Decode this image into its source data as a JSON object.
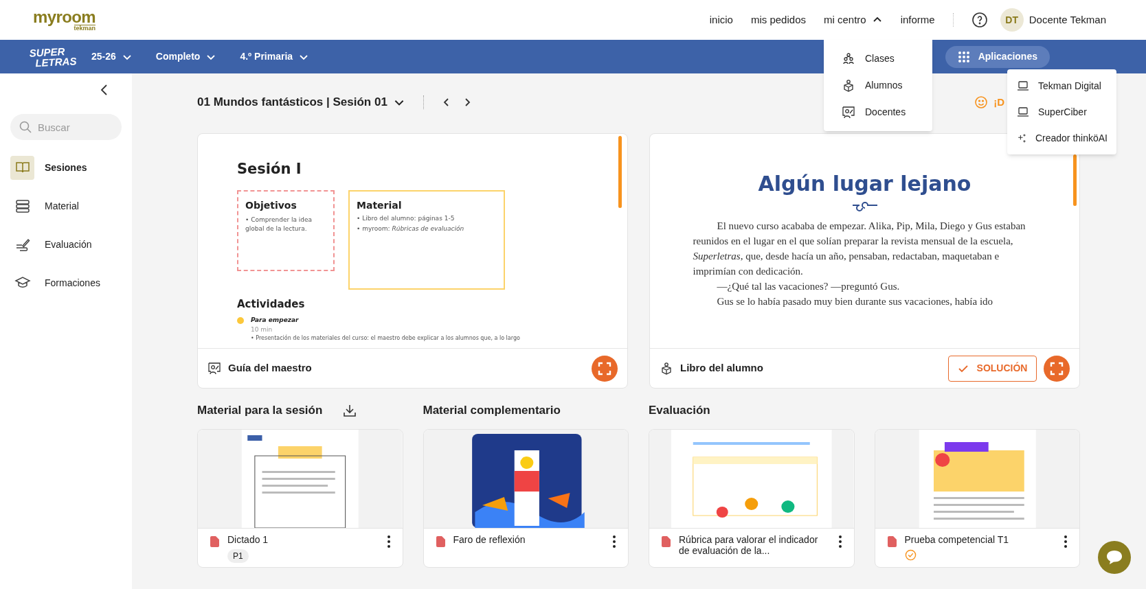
{
  "header": {
    "logo": "myroom",
    "logo_sub": "tekman",
    "nav": [
      {
        "label": "inicio",
        "kind": "link"
      },
      {
        "label": "mis pedidos",
        "kind": "link"
      },
      {
        "label": "mi centro",
        "kind": "menu",
        "expanded": true
      },
      {
        "label": "informe",
        "kind": "link"
      }
    ],
    "user": {
      "initials": "DT",
      "name": "Docente Tekman"
    }
  },
  "centro_menu": [
    {
      "label": "Clases",
      "kind": "group"
    },
    {
      "label": "Alumnos",
      "kind": "student"
    },
    {
      "label": "Docentes",
      "kind": "teacher"
    }
  ],
  "toolbar": {
    "brand_top": "SUPER",
    "brand_bottom": "LETRAS",
    "filters": [
      "25-26",
      "Completo",
      "4.º Primaria"
    ],
    "apps_button": "Aplicaciones",
    "apps_open": true
  },
  "apps_menu": [
    {
      "label": "Tekman Digital",
      "kind": "laptop"
    },
    {
      "label": "SuperCiber",
      "kind": "laptop"
    },
    {
      "label": "Creador thinköAI",
      "kind": "sparkle"
    }
  ],
  "sidebar": {
    "search": {
      "placeholder": "Buscar"
    },
    "items": [
      {
        "label": "Sesiones",
        "kind": "book",
        "selected": true
      },
      {
        "label": "Material",
        "kind": "stack",
        "selected": false
      },
      {
        "label": "Evaluación",
        "kind": "pen",
        "selected": false
      },
      {
        "label": "Formaciones",
        "kind": "cap",
        "selected": false
      }
    ]
  },
  "session": {
    "title": "01 Mundos fantásticos | Sesión 01",
    "feedback": "¡D"
  },
  "teacher_card": {
    "label": "Guía del maestro",
    "preview": {
      "title": "Sesión I",
      "objectives_title": "Objetivos",
      "objectives": [
        "• Comprender la idea global de la lectura."
      ],
      "material_title": "Material",
      "material": [
        "• Libro del alumno: páginas 1-5",
        "• myroom: *Rúbricas de evaluación*"
      ],
      "activities_title": "Actividades",
      "activity_name": "Para empezar",
      "activity_time": "10 min",
      "activity_text": "• Presentación de los materiales del curso: el maestro debe explicar a los alumnos que, a lo largo"
    }
  },
  "student_card": {
    "label": "Libro del alumno",
    "solution": "SOLUCIÓN",
    "preview": {
      "title": "Algún lugar lejano",
      "paragraphs": [
        {
          "text": "El nuevo curso acababa de empezar. Alika, Pip, Mila, Diego y Gus estaban reunidos en el lugar en el que solían preparar la revista mensual de la escuela, *Superletras*, que, desde hacía un año, pensaban, redactaban, maquetaban e imprimían con dedicación."
        },
        {
          "text": "—¿Qué tal las vacaciones? —preguntó Gus."
        },
        {
          "text": "Gus se lo había pasado muy bien durante sus vacaciones, había ido"
        }
      ]
    }
  },
  "sections": [
    {
      "title": "Material para la sesión",
      "download": true,
      "cards": [
        {
          "title": "Dictado 1",
          "tag": "P1",
          "done": false
        }
      ]
    },
    {
      "title": "Material complementario",
      "download": false,
      "cards": [
        {
          "title": "Faro de reflexión",
          "done": false
        }
      ]
    },
    {
      "title": "Evaluación",
      "download": false,
      "cards": [
        {
          "title": "Rúbrica para valorar el indicador de evaluación de la...",
          "done": false
        },
        {
          "title": "Prueba competencial T1",
          "done": true
        }
      ]
    }
  ]
}
